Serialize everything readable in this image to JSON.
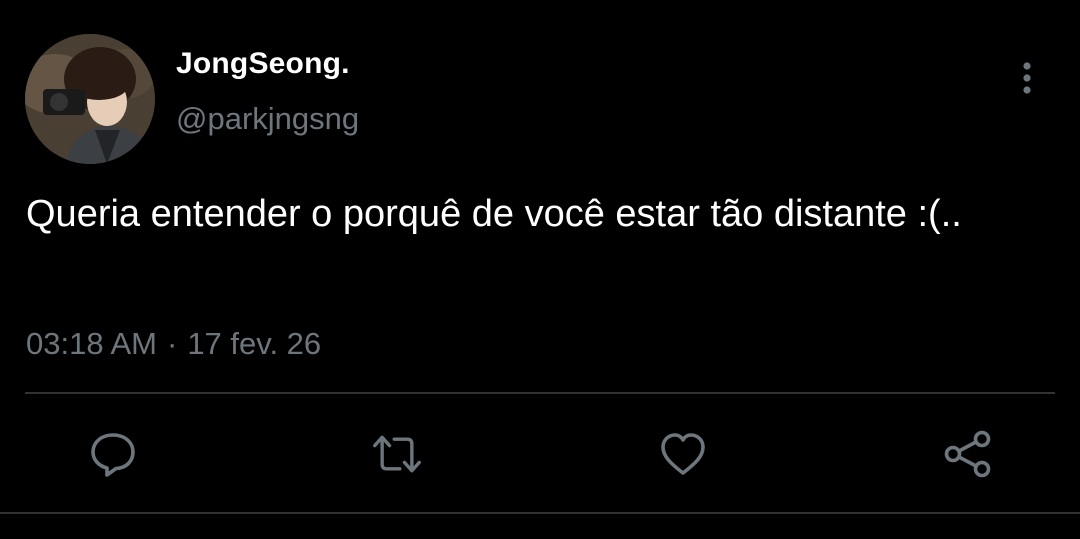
{
  "author": {
    "display_name": "JongSeong.",
    "handle": "@parkjngsng",
    "avatar_icon": "profile-photo"
  },
  "tweet": {
    "text": "Queria entender o porquê de você estar tão distante :(..",
    "time": "03:18 AM",
    "separator": "·",
    "date": "17 fev. 26"
  },
  "actions": [
    {
      "name": "reply",
      "icon": "comment-icon"
    },
    {
      "name": "retweet",
      "icon": "retweet-icon"
    },
    {
      "name": "like",
      "icon": "heart-icon"
    },
    {
      "name": "share",
      "icon": "share-icon"
    }
  ],
  "colors": {
    "background": "#000000",
    "primary_text": "#ffffff",
    "secondary_text": "#6e767d",
    "divider": "#2f3336"
  }
}
